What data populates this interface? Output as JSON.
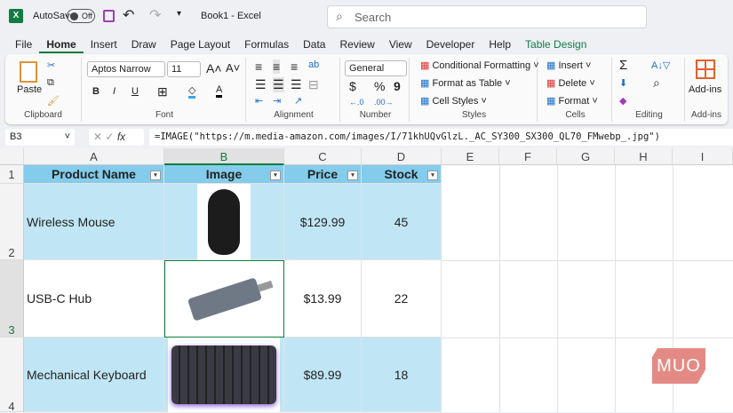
{
  "titlebar": {
    "autosave": "AutoSave",
    "toggle": "Off",
    "doc_title": "Book1  -  Excel",
    "search_placeholder": "Search"
  },
  "tabs": [
    "File",
    "Home",
    "Insert",
    "Draw",
    "Page Layout",
    "Formulas",
    "Data",
    "Review",
    "View",
    "Developer",
    "Help",
    "Table Design"
  ],
  "ribbon": {
    "clipboard": {
      "paste": "Paste",
      "label": "Clipboard"
    },
    "font": {
      "name": "Aptos Narrow",
      "size": "11",
      "bold": "B",
      "italic": "I",
      "underline": "U",
      "label": "Font"
    },
    "alignment": {
      "label": "Alignment"
    },
    "number": {
      "format": "General",
      "currency": "$",
      "percent": "%",
      "comma": "9",
      "label": "Number"
    },
    "styles": {
      "conditional": "Conditional Formatting",
      "format_table": "Format as Table",
      "cell_styles": "Cell Styles",
      "label": "Styles"
    },
    "cells": {
      "insert": "Insert",
      "delete": "Delete",
      "format": "Format",
      "label": "Cells"
    },
    "editing": {
      "sum": "Σ",
      "label": "Editing"
    },
    "addins": {
      "button": "Add-ins",
      "label": "Add-ins"
    }
  },
  "formula_bar": {
    "name_box": "B3",
    "fx": "fx",
    "formula": "=IMAGE(\"https://m.media-amazon.com/images/I/71khUQvGlzL._AC_SY300_SX300_QL70_FMwebp_.jpg\")"
  },
  "columns": [
    "A",
    "B",
    "C",
    "D",
    "E",
    "F",
    "G",
    "H",
    "I"
  ],
  "rows": [
    "1",
    "2",
    "3",
    "4"
  ],
  "table": {
    "headers": [
      "Product Name",
      "Image",
      "Price",
      "Stock"
    ],
    "rows": [
      {
        "name": "Wireless Mouse",
        "image": "mouse",
        "price": "$129.99",
        "stock": "45"
      },
      {
        "name": "USB-C Hub",
        "image": "usb-hub",
        "price": "$13.99",
        "stock": "22"
      },
      {
        "name": "Mechanical Keyboard",
        "image": "keyboard",
        "price": "$89.99",
        "stock": "18"
      }
    ]
  },
  "watermark": "MUO",
  "colors": {
    "header": "#83cceb",
    "band": "#c0e6f5",
    "accent": "#107c41"
  }
}
